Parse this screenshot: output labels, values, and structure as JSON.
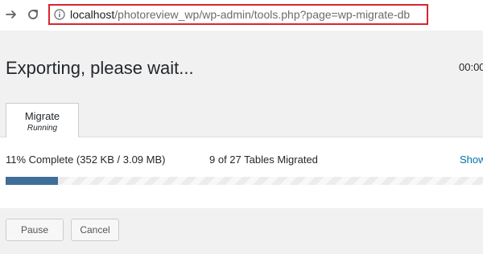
{
  "browser": {
    "url_host": "localhost",
    "url_path": "/photoreview_wp/wp-admin/tools.php?page=wp-migrate-db",
    "highlight_color": "#d7262e",
    "icons": [
      "arrow-right-icon",
      "reload-icon",
      "info-icon"
    ]
  },
  "page": {
    "title": "Exporting, please wait...",
    "timer": "00:00"
  },
  "tab": {
    "label": "Migrate",
    "status": "Running"
  },
  "progress": {
    "complete_text": "11% Complete (352 KB / 3.09 MB)",
    "tables_text": "9 of 27 Tables Migrated",
    "show_link": "Show",
    "percent": 11,
    "bar_color": "#3f6e9a"
  },
  "buttons": {
    "pause": "Pause",
    "cancel": "Cancel"
  }
}
